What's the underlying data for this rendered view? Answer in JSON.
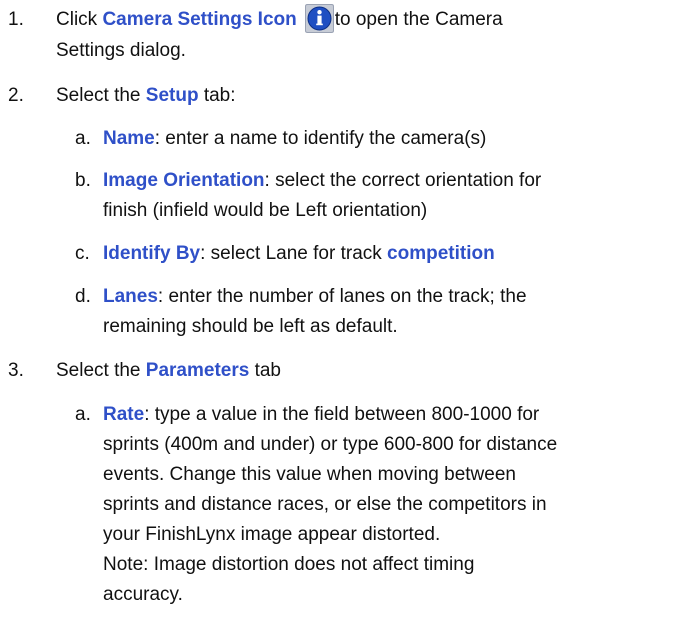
{
  "steps": {
    "s1": {
      "number": "1.",
      "pre": "Click ",
      "keyword": "Camera Settings Icon",
      "after_icon": "to open the Camera",
      "line2": "Settings dialog.",
      "icon": "info-icon"
    },
    "s2": {
      "number": "2.",
      "pre": "Select the ",
      "keyword": "Setup",
      "post": " tab:",
      "subs": {
        "a": {
          "letter": "a.",
          "keyword": "Name",
          "text": ": enter a name to identify the camera(s)"
        },
        "b": {
          "letter": "b.",
          "keyword": "Image Orientation",
          "text": ": select the correct orientation for",
          "line2": "finish (infield would be Left orientation)"
        },
        "c": {
          "letter": "c.",
          "keyword": "Identify By",
          "text": ": select Lane for track ",
          "keyword2": "competition"
        },
        "d": {
          "letter": "d.",
          "keyword": "Lanes",
          "text": ": enter the number of lanes on the track; the",
          "line2": "remaining should be left as default."
        }
      }
    },
    "s3": {
      "number": "3.",
      "pre": "Select the ",
      "keyword": "Parameters",
      "post": " tab",
      "subs": {
        "a": {
          "letter": "a.",
          "keyword": "Rate",
          "text": ": type a value in the field between 800-1000 for",
          "line2": "sprints (400m and under) or type 600-800 for distance",
          "line3": "events. Change this value when moving between",
          "line4": "sprints and distance races, or else the competitors in",
          "line5": "your FinishLynx image appear distorted.",
          "line6": "Note: Image distortion does not affect timing",
          "line7": "accuracy."
        }
      }
    }
  },
  "colors": {
    "keyword": "#2f50c8",
    "icon_fill": "#1f4fc2",
    "icon_bg": "#c7ccd6"
  }
}
